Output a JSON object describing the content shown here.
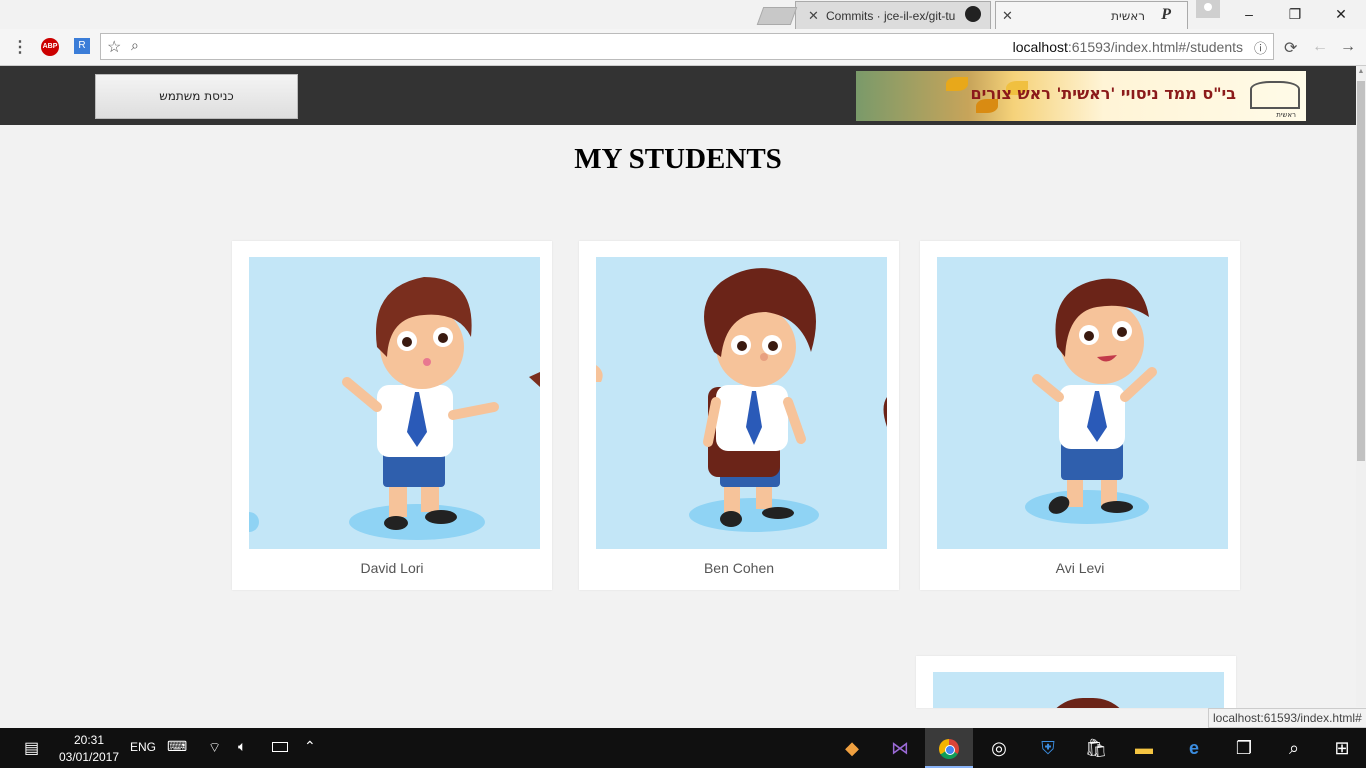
{
  "browser": {
    "tabs": [
      {
        "title": "ראשית",
        "active": true
      },
      {
        "title": "Commits · jce-il-ex/git-tu",
        "active": false
      }
    ],
    "url_host": "localhost",
    "url_rest": ":61593/index.html#/students",
    "status_url": "localhost:61593/index.html#",
    "window_controls": {
      "minimize": "–",
      "maximize": "❐",
      "close": "✕"
    }
  },
  "header": {
    "login_label": "כניסת משתמש",
    "banner_text": "בי\"ס ממד ניסויי 'ראשית' ראש צורים",
    "banner_small": "ראשית"
  },
  "page": {
    "title": "MY STUDENTS",
    "students": [
      {
        "name": "David Lori"
      },
      {
        "name": "Ben Cohen"
      },
      {
        "name": "Avi Levi"
      }
    ]
  },
  "taskbar": {
    "time": "20:31",
    "date": "03/01/2017",
    "lang": "ENG"
  },
  "colors": {
    "header_bg": "#333333",
    "page_bg": "#f2f2f2",
    "card_bg": "#ffffff",
    "photo_bg": "#c3e6f7"
  }
}
